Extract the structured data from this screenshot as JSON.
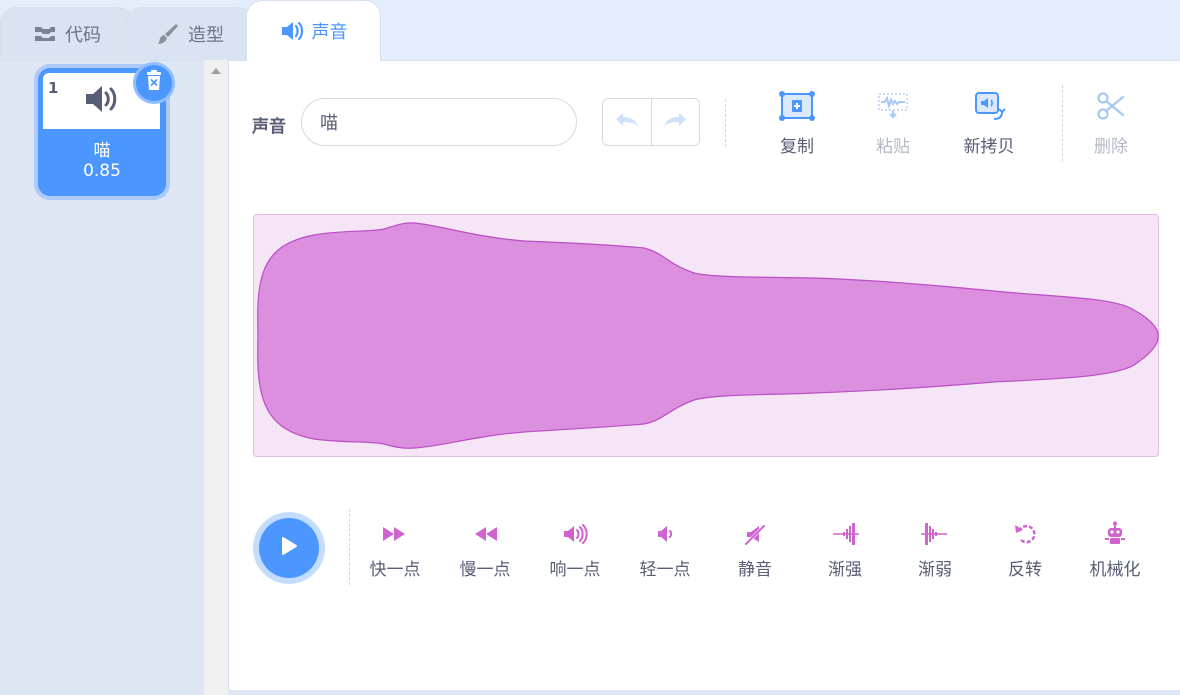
{
  "tabs": [
    {
      "label": "代码",
      "icon": "code-icon"
    },
    {
      "label": "造型",
      "icon": "brush-icon"
    },
    {
      "label": "声音",
      "icon": "speaker-icon",
      "active": true
    }
  ],
  "sound_list": {
    "items": [
      {
        "index": "1",
        "name": "喵",
        "duration": "0.85",
        "icon": "speaker-icon",
        "selected": true
      }
    ]
  },
  "editor": {
    "sound_label": "声音",
    "sound_name_value": "喵",
    "undo_icon": "undo-icon",
    "redo_icon": "redo-icon",
    "toolbar": {
      "copy": "复制",
      "paste": "粘贴",
      "copy_to_new": "新拷贝",
      "delete": "删除"
    },
    "effects": [
      {
        "label": "快一点",
        "icon": "fast-forward-icon"
      },
      {
        "label": "慢一点",
        "icon": "rewind-icon"
      },
      {
        "label": "响一点",
        "icon": "louder-icon"
      },
      {
        "label": "轻一点",
        "icon": "softer-icon"
      },
      {
        "label": "静音",
        "icon": "mute-icon"
      },
      {
        "label": "渐强",
        "icon": "fade-in-icon"
      },
      {
        "label": "渐弱",
        "icon": "fade-out-icon"
      },
      {
        "label": "反转",
        "icon": "reverse-icon"
      },
      {
        "label": "机械化",
        "icon": "robot-icon"
      }
    ]
  },
  "colors": {
    "accent": "#4c97ff",
    "waveform_fill": "#dc8fdf",
    "waveform_stroke": "#b84fc2",
    "effect_icon": "#cf63cf"
  }
}
